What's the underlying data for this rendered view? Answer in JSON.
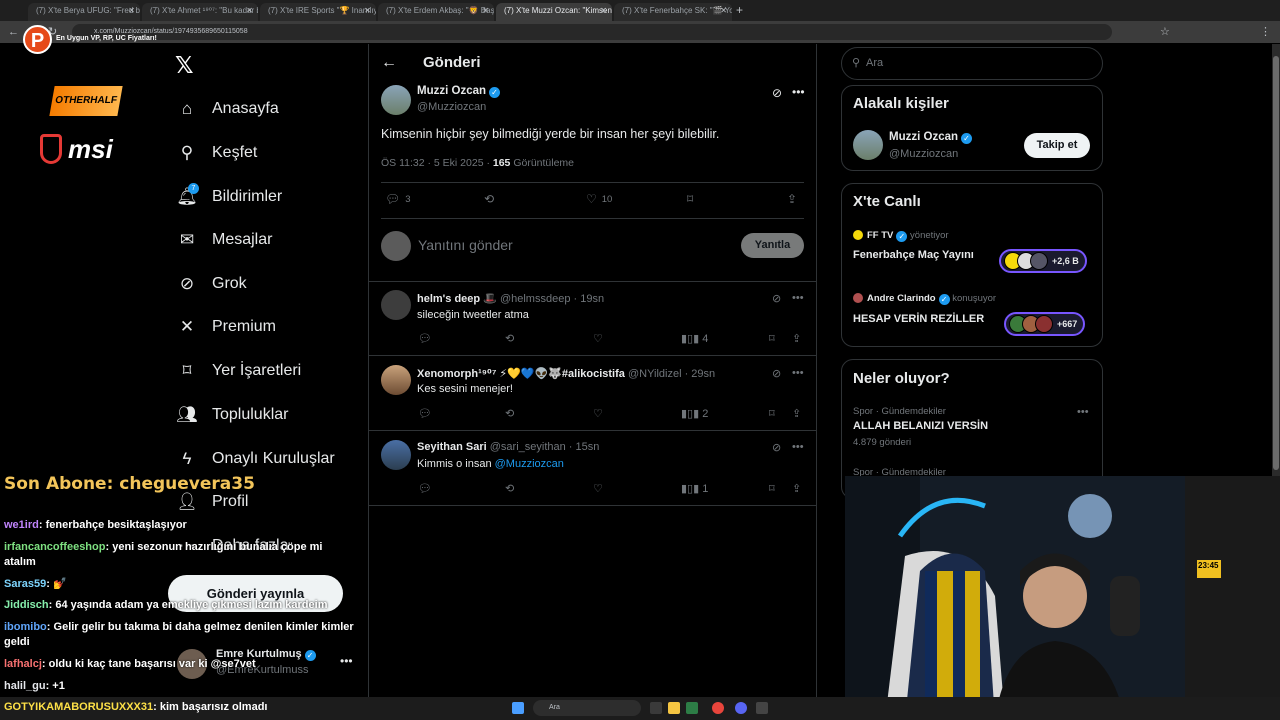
{
  "browser": {
    "tabs": [
      {
        "label": "(7) X'te Berya UFUG: \"Fred bend..."
      },
      {
        "label": "(7) X'te Ahmet ¹⁹⁰⁷: \"Bu kadar bgu..."
      },
      {
        "label": "(7) X'te IRE Sports \"🏆 Inanılıyor..."
      },
      {
        "label": "(7) X'te Erdem Akbaş: \"🦁 Başk..."
      },
      {
        "label": "(7) X'te Muzzi Ozcan: \"Kimsenin..."
      },
      {
        "label": "(7) X'te Fenerbahçe SK: \"🎬 Yo..."
      }
    ],
    "url": "x.com/Muzziozcan/status/1974935689650115058"
  },
  "overlay": {
    "logo_text": "En Uygun VP, RP, UC Fiyatları!",
    "stream_logo_text": "OTHERHALF",
    "sponsor": "msi",
    "last_sub": "Son Abone: cheguevera35",
    "chat": [
      {
        "user": "we1ird",
        "user_color": "#c084fc",
        "msg": "fenerbahçe besiktaşlaşıyor"
      },
      {
        "user": "irfancancoffeeshop",
        "user_color": "#7ee081",
        "msg": "yeni sezonun hazırlığını bunalıa çöpe mi atalım"
      },
      {
        "user": "Saras59",
        "user_color": "#7dd3fc",
        "msg": "💅"
      },
      {
        "user": "Jiddisch",
        "user_color": "#86efac",
        "msg": "64 yaşında adam ya emekliye çıkmesi lazım kardeim"
      },
      {
        "user": "ibomibo",
        "user_color": "#60a5fa",
        "msg": "Gelir gelir bu takıma bi daha gelmez denilen kimler kimler geldi"
      },
      {
        "user": "lafhalcj",
        "user_color": "#f87171",
        "msg": "oldu ki kaç tane başarısı var ki @se7vet"
      },
      {
        "user": "halil_gu",
        "user_color": "#e5e7eb",
        "msg": "+1"
      },
      {
        "user": "GOTYIKAMABORUSUXXX31",
        "user_color": "#fde047",
        "msg": "kim başarısız olmadı"
      }
    ]
  },
  "nav": {
    "items": [
      {
        "label": "Anasayfa",
        "icon": "home-icon"
      },
      {
        "label": "Keşfet",
        "icon": "search-icon"
      },
      {
        "label": "Bildirimler",
        "icon": "bell-icon"
      },
      {
        "label": "Mesajlar",
        "icon": "mail-icon"
      },
      {
        "label": "Grok",
        "icon": "grok-icon"
      },
      {
        "label": "Premium",
        "icon": "x-icon"
      },
      {
        "label": "Yer İşaretleri",
        "icon": "bookmark-icon"
      },
      {
        "label": "Topluluklar",
        "icon": "people-icon"
      },
      {
        "label": "Onaylı Kuruluşlar",
        "icon": "lightning-icon"
      },
      {
        "label": "Profil",
        "icon": "person-icon"
      },
      {
        "label": "Daha fazla",
        "icon": "more-icon"
      }
    ],
    "notif_count": "7",
    "post_button": "Gönderi yayınla",
    "account_name": "Emre Kurtulmuş",
    "account_handle": "@EmreKurtulmuss"
  },
  "post": {
    "page_title": "Gönderi",
    "author": "Muzzi Ozcan",
    "handle": "@Muzziozcan",
    "text": "Kimsenin hiçbir şey bilmediği yerde bir insan her şeyi bilebilir.",
    "time": "ÖS 11:32 · 5 Eki 2025 · ",
    "views": "165",
    "views_label": " Görüntüleme",
    "replies": "3",
    "likes": "10",
    "reply_placeholder": "Yanıtını gönder",
    "reply_button": "Yanıtla"
  },
  "replies": [
    {
      "name": "helm's deep 🎩",
      "handle": "@helmssdeep · 19sn",
      "text": "sileceğin tweetler atma",
      "mention": "",
      "views": "4"
    },
    {
      "name": "Xenomorph¹⁹⁰⁷ ⚡💛💙👽🐺#alikocistifa",
      "handle": "@NYildizel · 29sn",
      "text": "Kes sesini menejer!",
      "mention": "",
      "views": "2"
    },
    {
      "name": "Seyithan Sari",
      "handle": "@sari_seyithan · 15sn",
      "text": "Kimmis o insan ",
      "mention": "@Muzziozcan",
      "views": "1"
    }
  ],
  "sidebar": {
    "search_placeholder": "Ara",
    "related_title": "Alakalı kişiler",
    "related_name": "Muzzi Ozcan",
    "related_handle": "@Muzziozcan",
    "follow_button": "Takip et",
    "live_title": "X'te Canlı",
    "live": [
      {
        "host": "FF TV",
        "role": "yönetiyor",
        "title": "Fenerbahçe Maç Yayını",
        "count": "+2,6 B"
      },
      {
        "host": "Andre Clarindo",
        "role": "konuşuyor",
        "title": "HESAP VERİN REZİLLER",
        "count": "+667"
      }
    ],
    "trends_title": "Neler oluyor?",
    "trends": [
      {
        "meta": "Spor · Gündemdekiler",
        "title": "ALLAH BELANIZI VERSİN",
        "count": "4.879 gönderi"
      },
      {
        "meta": "Spor · Gündemdekiler",
        "title": "",
        "count": ""
      }
    ]
  },
  "taskbar": {
    "search": "Ara"
  },
  "webcam": {
    "clock": "23:45"
  },
  "colors": {
    "accent": "#1d9bf0",
    "bg": "#000000",
    "border": "#2f3336",
    "muted": "#71767b"
  }
}
